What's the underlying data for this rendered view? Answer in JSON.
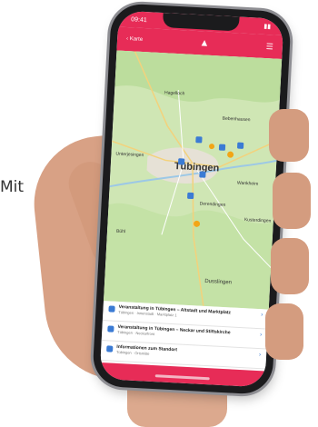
{
  "side_text": "Mit",
  "status_bar": {
    "time": "09:41"
  },
  "app_bar": {
    "back_label": "Karte"
  },
  "map": {
    "city_label": "Tübingen",
    "labels": [
      "Hagelloch",
      "Bebenhausen",
      "Unterjesingen",
      "Derendingen",
      "Wankheim",
      "Bühl",
      "Kusterdingen",
      "Dusslingen"
    ]
  },
  "list": {
    "items": [
      {
        "title": "Veranstaltung in Tübingen – Altstadt und Marktplatz",
        "subtitle": "Tübingen · Innenstadt · Marktplatz 1"
      },
      {
        "title": "Veranstaltung in Tübingen – Neckar und Stiftskirche",
        "subtitle": "Tübingen · Neckarfront"
      },
      {
        "title": "Informationen zum Standort",
        "subtitle": "Tübingen · Ortsmitte"
      }
    ]
  },
  "colors": {
    "accent": "#e72c57",
    "map_green": "#cfe6b4",
    "marker_blue": "#3b7bd4",
    "marker_orange": "#f2a516"
  },
  "icons": {
    "app_logo": "flame-icon",
    "menu": "menu-icon",
    "marker": "map-pin-icon"
  }
}
